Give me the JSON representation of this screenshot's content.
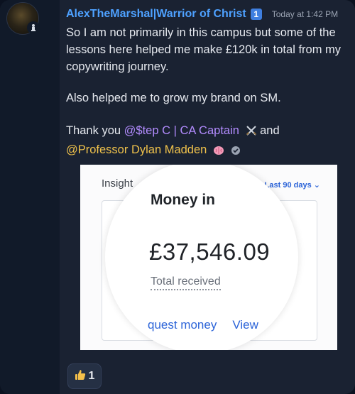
{
  "message": {
    "author": "AlexTheMarshal|Warrior of Christ",
    "role_badge": "1",
    "timestamp": "Today at 1:42 PM",
    "lines": {
      "p1": "So I am not primarily in this campus but some of the lessons here helped me make £120k in total from my copywriting journey.",
      "p2": "Also helped me to grow my brand on SM.",
      "p3_prefix": "Thank you ",
      "mention1": "@$tep C | CA Captain",
      "p3_and": " and",
      "mention2": "@Professor Dylan Madden"
    }
  },
  "attachment": {
    "insights_label": "Insight",
    "range_label": "Last 90 days",
    "card_title": "Money in",
    "amount": "£37,546.09",
    "amount_label": "Total received",
    "action1": "quest money",
    "action2": "View"
  },
  "reaction": {
    "emoji": "thumbs-up-icon",
    "count": "1"
  },
  "colors": {
    "link": "#4ea1ff",
    "mention_purple": "#b38cff",
    "mention_gold": "#f0c24b",
    "bg": "#1a2232"
  }
}
